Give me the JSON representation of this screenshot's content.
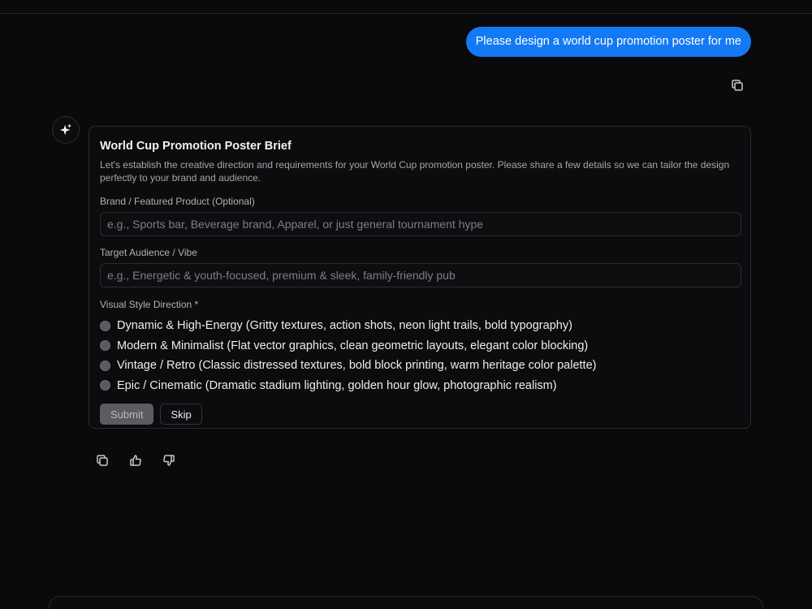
{
  "user_message": {
    "text": "Please design a world cup promotion poster for me"
  },
  "card": {
    "title": "World Cup Promotion Poster Brief",
    "description": "Let's establish the creative direction and requirements for your World Cup promotion poster. Please share a few details so we can tailor the design perfectly to your brand and audience.",
    "fields": {
      "brand": {
        "label": "Brand / Featured Product (Optional)",
        "placeholder": "e.g., Sports bar, Beverage brand, Apparel, or just general tournament hype",
        "value": ""
      },
      "audience": {
        "label": "Target Audience / Vibe",
        "placeholder": "e.g., Energetic & youth-focused, premium & sleek, family-friendly pub",
        "value": ""
      }
    },
    "style_label": "Visual Style Direction *",
    "style_options": [
      "Dynamic & High-Energy (Gritty textures, action shots, neon light trails, bold typography)",
      "Modern & Minimalist (Flat vector graphics, clean geometric layouts, elegant color blocking)",
      "Vintage / Retro (Classic distressed textures, bold block printing, warm heritage color palette)",
      "Epic / Cinematic (Dramatic stadium lighting, golden hour glow, photographic realism)"
    ],
    "buttons": {
      "submit": "Submit",
      "skip": "Skip"
    }
  },
  "icons": {
    "copy_user": "copy-icon",
    "avatar": "sparkle-icon",
    "copy_reply": "copy-icon",
    "like": "thumbs-up-icon",
    "dislike": "thumbs-down-icon"
  },
  "colors": {
    "background": "#0a0a0c",
    "user_bubble": "#1479f5",
    "card_border": "#2a2a2e",
    "submit_disabled": "#5b5b60"
  }
}
